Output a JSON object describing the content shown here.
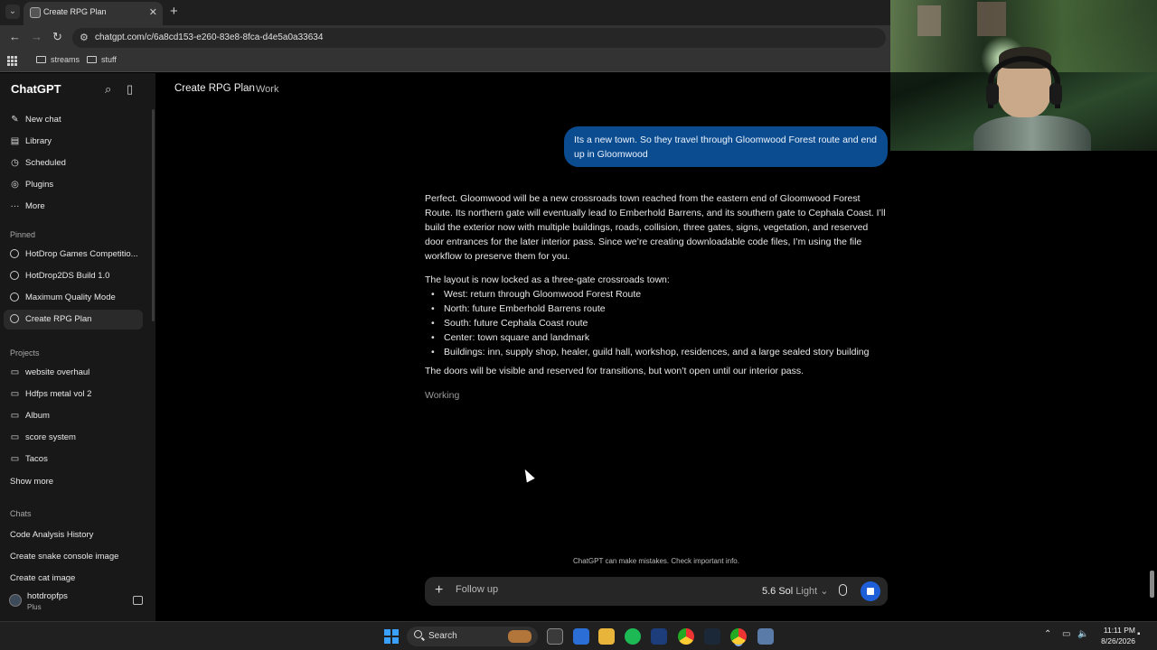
{
  "browser": {
    "tab_title": "Create RPG Plan",
    "url": "chatgpt.com/c/6a8cd153-e260-83e8-8fca-d4e5a0a33634",
    "bookmarks": [
      "streams",
      "stuff"
    ]
  },
  "sidebar": {
    "app_name": "ChatGPT",
    "nav": [
      {
        "label": "New chat",
        "icon": "compose-icon"
      },
      {
        "label": "Library",
        "icon": "library-icon"
      },
      {
        "label": "Scheduled",
        "icon": "clock-icon"
      },
      {
        "label": "Plugins",
        "icon": "plugin-icon"
      },
      {
        "label": "More",
        "icon": "more-icon"
      }
    ],
    "pinned_heading": "Pinned",
    "pinned": [
      "HotDrop Games Competitio...",
      "HotDrop2DS Build 1.0",
      "Maximum Quality Mode",
      "Create RPG Plan"
    ],
    "projects_heading": "Projects",
    "projects": [
      "website overhaul",
      "Hdfps metal vol 2",
      "Album",
      "score system",
      "Tacos"
    ],
    "show_more": "Show more",
    "chats_heading": "Chats",
    "chats": [
      "Code Analysis History",
      "Create snake console image",
      "Create cat image"
    ],
    "user": {
      "name": "hotdropfps",
      "plan": "Plus"
    }
  },
  "header": {
    "title": "Create RPG Plan",
    "separator": "·",
    "project": "Work"
  },
  "conversation": {
    "user_message": "Its a new town. So they travel through Gloomwood Forest route and end up in Gloomwood",
    "assistant": {
      "paragraph1": "Perfect. Gloomwood will be a new crossroads town reached from the eastern end of Gloomwood Forest Route. Its northern gate will eventually lead to Emberhold Barrens, and its southern gate to Cephala Coast. I’ll build the exterior now with multiple buildings, roads, collision, three gates, signs, vegetation, and reserved door entrances for the later interior pass. Since we’re creating downloadable code files, I’m using the file workflow to preserve them for you.",
      "paragraph2": "The layout is now locked as a three-gate crossroads town:",
      "bullets": [
        "West: return through Gloomwood Forest Route",
        "North: future Emberhold Barrens route",
        "South: future Cephala Coast route",
        "Center: town square and landmark",
        "Buildings: inn, supply shop, healer, guild hall, workshop, residences, and a large sealed story building"
      ],
      "paragraph3": "The doors will be visible and reserved for transitions, but won’t open until our interior pass.",
      "status": "Working"
    }
  },
  "composer": {
    "placeholder": "Follow up",
    "model_name": "5.6 Sol",
    "model_mode": "Light",
    "disclaimer": "ChatGPT can make mistakes. Check important info."
  },
  "taskbar": {
    "search_label": "Search",
    "time": "11:11 PM",
    "date": "8/26/2026"
  },
  "colors": {
    "user_bubble": "#0a4c8f",
    "stop_button": "#1e5fd8",
    "sidebar_bg": "#181818"
  }
}
